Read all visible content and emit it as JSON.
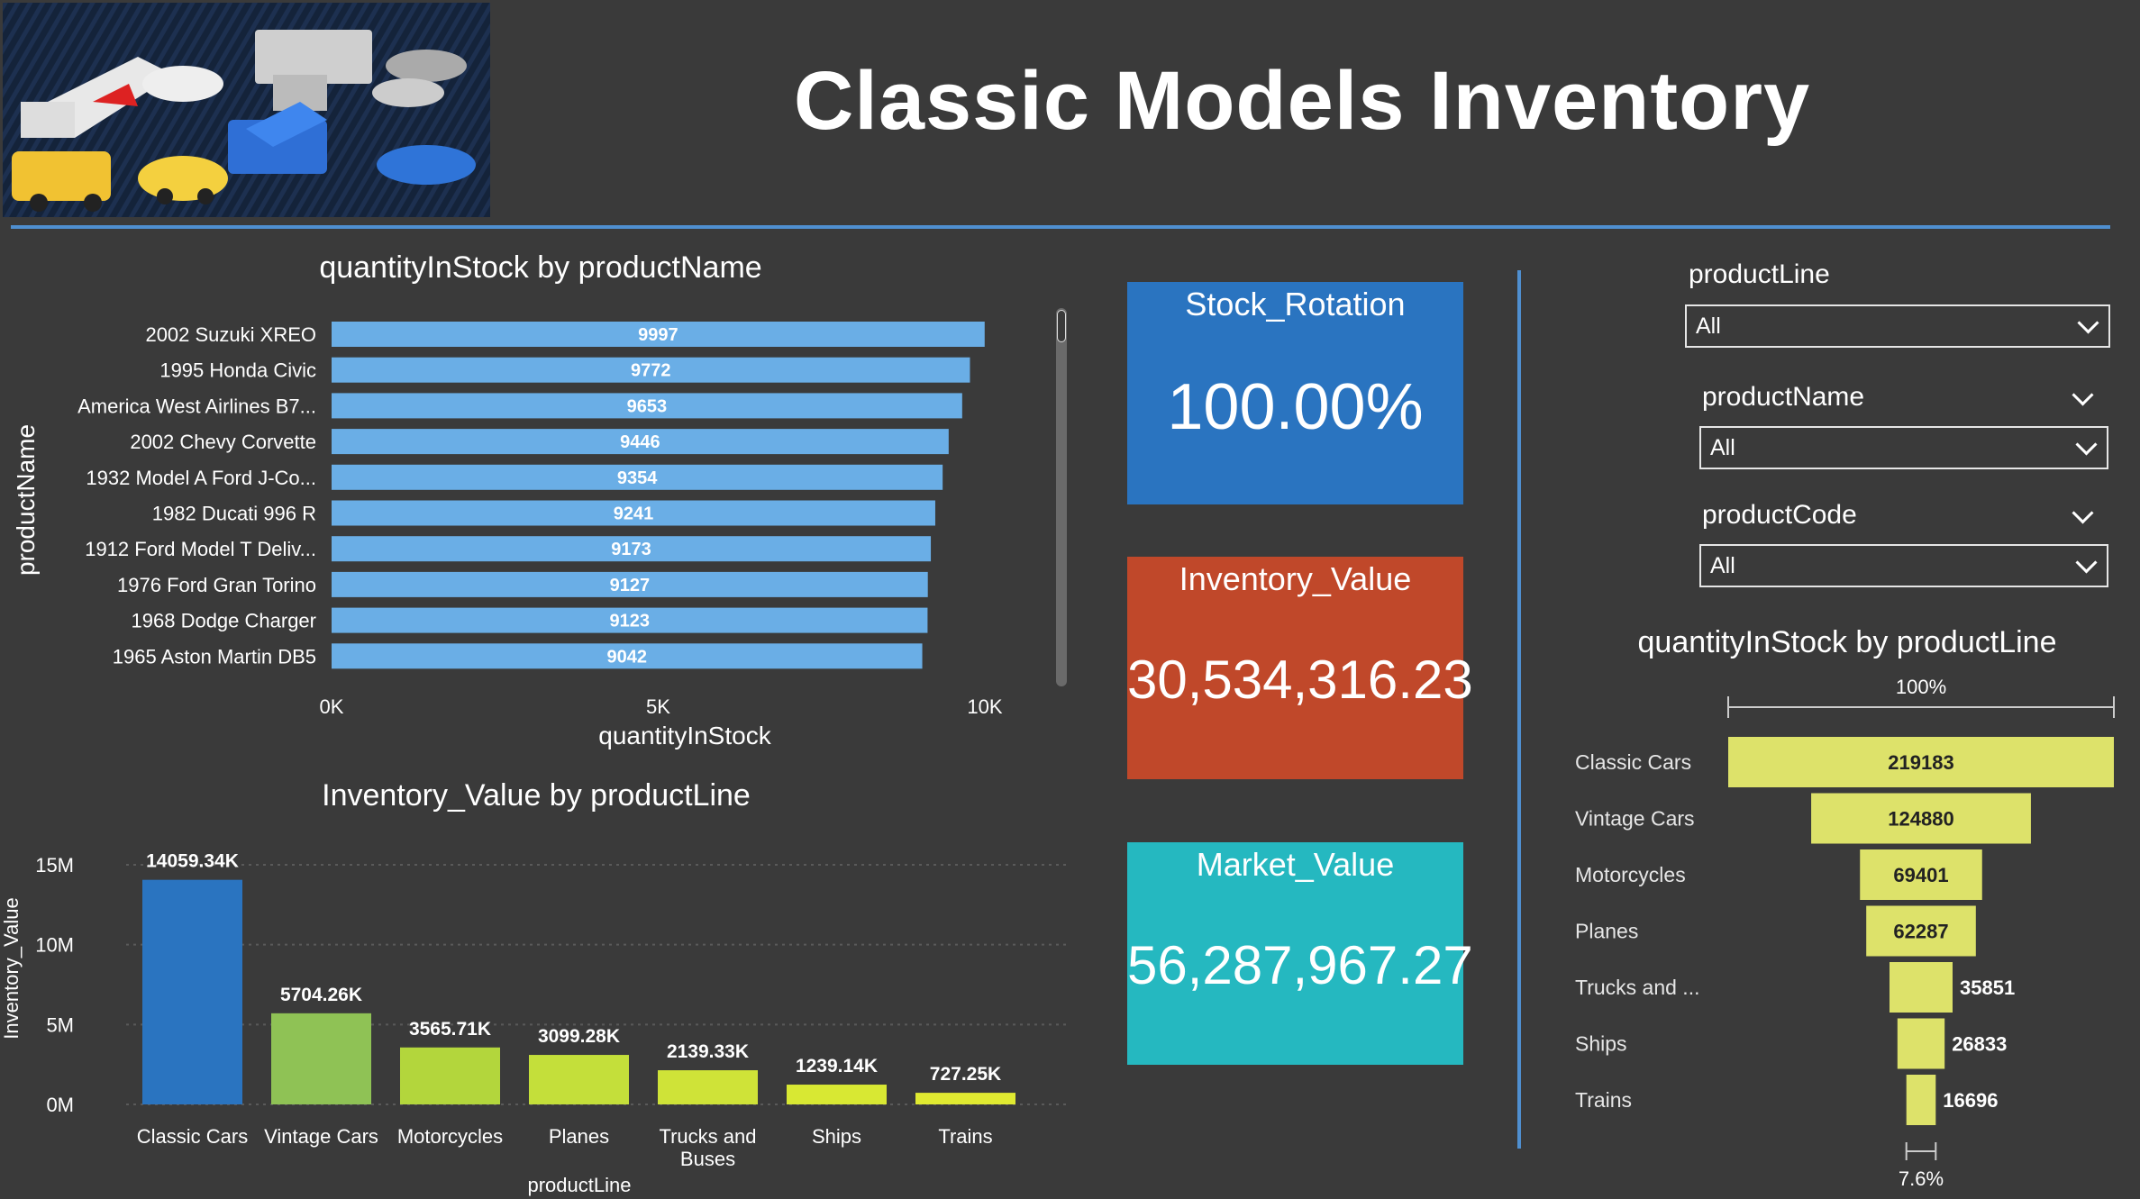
{
  "header": {
    "title": "Classic Models Inventory",
    "banner_image": "toy-cars-banner"
  },
  "bar_chart": {
    "title": "quantityInStock by productName",
    "ylabel": "productName",
    "xlabel": "quantityInStock"
  },
  "column_chart": {
    "title": "Inventory_Value by productLine",
    "ylabel": "Inventory_Value",
    "xlabel": "productLine"
  },
  "cards": {
    "stock_rotation": {
      "label": "Stock_Rotation",
      "value": "100.00%",
      "color": "#2a74c0"
    },
    "inventory_value": {
      "label": "Inventory_Value",
      "value": "30,534,316.23",
      "color": "#c0482a"
    },
    "market_value": {
      "label": "Market_Value",
      "value": "56,287,967.27",
      "color": "#25b8c0"
    }
  },
  "slicers": {
    "product_line": {
      "label": "productLine",
      "value": "All"
    },
    "product_name": {
      "label": "productName",
      "value": "All"
    },
    "product_code": {
      "label": "productCode",
      "value": "All"
    }
  },
  "funnel_chart": {
    "title": "quantityInStock by productLine",
    "top_label": "100%",
    "bottom_label": "7.6%"
  },
  "colors": {
    "background": "#3a3a3a",
    "accent": "#4f8fd0",
    "bar_blue": "#6aaee6",
    "funnel_yellow": "#dde26a"
  },
  "chart_data": [
    {
      "type": "bar",
      "orientation": "horizontal",
      "title": "quantityInStock by productName",
      "xlabel": "quantityInStock",
      "ylabel": "productName",
      "categories": [
        "2002 Suzuki XREO",
        "1995 Honda Civic",
        "America West Airlines B7...",
        "2002 Chevy Corvette",
        "1932 Model A Ford J-Co...",
        "1982 Ducati 996 R",
        "1912 Ford Model T Deliv...",
        "1976 Ford Gran Torino",
        "1968 Dodge Charger",
        "1965 Aston Martin DB5"
      ],
      "values": [
        9997,
        9772,
        9653,
        9446,
        9354,
        9241,
        9173,
        9127,
        9123,
        9042
      ],
      "data_labels": [
        "9997",
        "9772",
        "9653",
        "9446",
        "9354",
        "9241",
        "9173",
        "9127",
        "9123",
        "9042"
      ],
      "xlim": [
        0,
        10000
      ],
      "xticks": [
        0,
        5000,
        10000
      ],
      "xtick_labels": [
        "0K",
        "5K",
        "10K"
      ],
      "color": "#6aaee6"
    },
    {
      "type": "bar",
      "orientation": "vertical",
      "title": "Inventory_Value by productLine",
      "xlabel": "productLine",
      "ylabel": "Inventory_Value",
      "categories": [
        "Classic Cars",
        "Vintage Cars",
        "Motorcycles",
        "Planes",
        "Trucks and Buses",
        "Ships",
        "Trains"
      ],
      "values": [
        14059340,
        5704260,
        3565710,
        3099280,
        2139330,
        1239140,
        727250
      ],
      "data_labels": [
        "14059.34K",
        "5704.26K",
        "3565.71K",
        "3099.28K",
        "2139.33K",
        "1239.14K",
        "727.25K"
      ],
      "colors": [
        "#2a74c0",
        "#8fc255",
        "#b3d63c",
        "#c4df3a",
        "#cfe338",
        "#d8e833",
        "#e0ea31"
      ],
      "ylim": [
        0,
        15000000
      ],
      "yticks": [
        0,
        5000000,
        10000000,
        15000000
      ],
      "ytick_labels": [
        "0M",
        "5M",
        "10M",
        "15M"
      ]
    },
    {
      "type": "funnel",
      "title": "quantityInStock by productLine",
      "categories": [
        "Classic Cars",
        "Vintage Cars",
        "Motorcycles",
        "Planes",
        "Trucks and ...",
        "Ships",
        "Trains"
      ],
      "values": [
        219183,
        124880,
        69401,
        62287,
        35851,
        26833,
        16696
      ],
      "data_labels": [
        "219183",
        "124880",
        "69401",
        "62287",
        "35851",
        "26833",
        "16696"
      ],
      "top_percent": "100%",
      "bottom_percent": "7.6%",
      "color": "#dde26a"
    }
  ]
}
